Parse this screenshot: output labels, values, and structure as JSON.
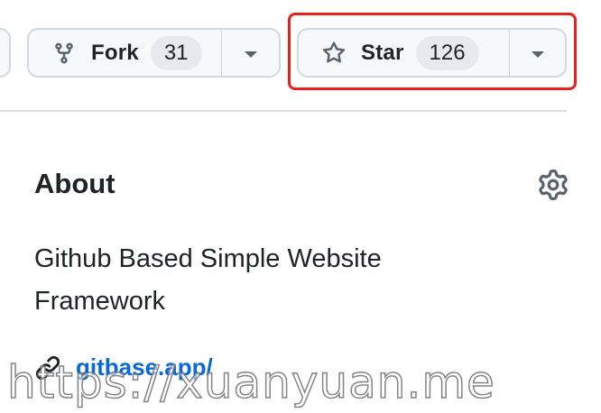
{
  "repo_actions": {
    "fork": {
      "icon": "repo-forked-icon",
      "label": "Fork",
      "count": "31"
    },
    "star": {
      "icon": "star-icon",
      "label": "Star",
      "count": "126"
    }
  },
  "about": {
    "heading": "About",
    "settings_icon": "gear-icon",
    "description": "Github Based Simple Website Framework",
    "website": {
      "icon": "link-icon",
      "text": "gitbase.app/"
    }
  },
  "watermark": "https://xuanyuan.me",
  "colors": {
    "highlight": "#e8221b",
    "link": "#0969da",
    "button_bg": "#f6f8fa",
    "counter_bg": "#e6eaef"
  }
}
